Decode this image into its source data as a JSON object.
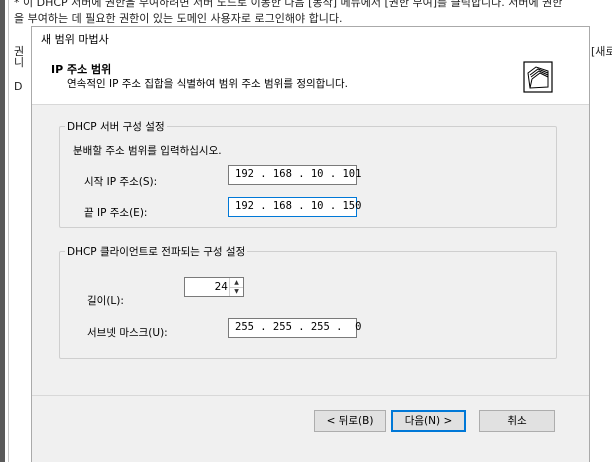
{
  "background": {
    "line1": "* 이 DHCP 서버에 권한을 부여하려면 서버 노드로 이동한 다음 [동작] 메뉴에서 [권한 부여]를 클릭합니다. 서버에 권한",
    "line2": "을 부여하는 데 필요한 권한이 있는 도메인 사용자로 로그인해야 합니다.",
    "frag_left1": "권",
    "frag_left2": "니",
    "frag_left3": "D",
    "frag_right": "[새로"
  },
  "dialog": {
    "title": "새 범위 마법사",
    "header_title": "IP 주소 범위",
    "header_subtitle": "연속적인 IP 주소 집합을 식별하여 범위 주소 범위를 정의합니다.",
    "header_icon": "folders-wizard-icon",
    "server_group": {
      "legend": "DHCP 서버 구성 설정",
      "instruction": "분배할 주소 범위를 입력하십시오.",
      "start_label": "시작 IP 주소(S):",
      "start_ip": "192 . 168 . 10 . 101",
      "end_label": "끝 IP 주소(E):",
      "end_ip": "192 . 168 . 10 . 150"
    },
    "client_group": {
      "legend": "DHCP 클라이언트로 전파되는 구성 설정",
      "length_label": "길이(L):",
      "length_value": "24",
      "mask_label": "서브넷 마스크(U):",
      "mask_value": "255 . 255 . 255 .  0"
    },
    "buttons": {
      "back": "< 뒤로(B)",
      "next": "다음(N) >",
      "cancel": "취소"
    }
  }
}
